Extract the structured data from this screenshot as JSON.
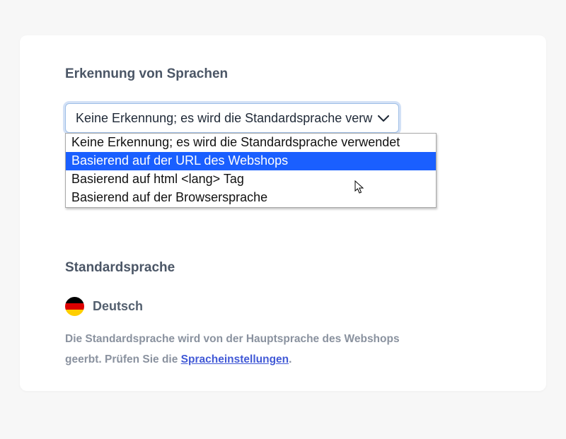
{
  "section1": {
    "heading": "Erkennung von Sprachen",
    "select": {
      "displayed": "Keine Erkennung; es wird die Standardsprache verw",
      "options": [
        "Keine Erkennung; es wird die Standardsprache verwendet",
        "Basierend auf der URL des Webshops",
        "Basierend auf html <lang> Tag",
        "Basierend auf der Browsersprache"
      ],
      "highlightedIndex": 1
    }
  },
  "section2": {
    "heading": "Standardsprache",
    "langLabel": "Deutsch",
    "helpText1": "Die Standardsprache wird von der Hauptsprache des Webshops",
    "helpText2a": "geerbt. Prüfen Sie die",
    "helpLink": "Spracheinstellungen",
    "helpText2b": "."
  }
}
